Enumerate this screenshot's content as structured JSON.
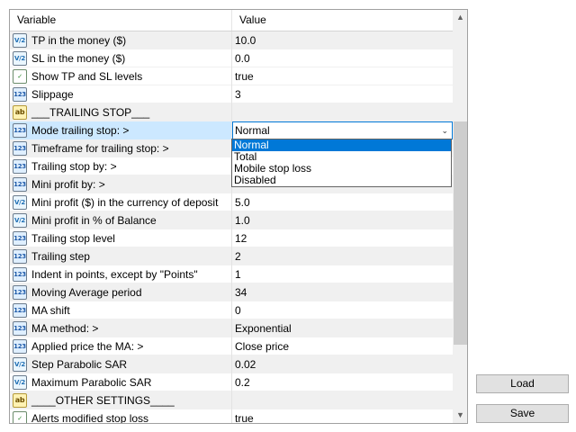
{
  "grid": {
    "headers": {
      "variable": "Variable",
      "value": "Value"
    },
    "rows": [
      {
        "type": "dbl",
        "icon_text": "V/2",
        "name": "TP in the money ($)",
        "value": "10.0",
        "style": "alt"
      },
      {
        "type": "dbl",
        "icon_text": "V/2",
        "name": "SL in the money ($)",
        "value": "0.0",
        "style": ""
      },
      {
        "type": "bool",
        "icon_text": "✓",
        "name": "Show TP and SL levels",
        "value": "true",
        "style": ""
      },
      {
        "type": "int",
        "icon_text": "123",
        "name": "Slippage",
        "value": "3",
        "style": ""
      },
      {
        "type": "str",
        "icon_text": "ab",
        "name": "___TRAILING STOP___",
        "value": "",
        "style": "sep"
      },
      {
        "type": "int",
        "icon_text": "123",
        "name": "Mode trailing stop: >",
        "value": "Normal",
        "style": "sel",
        "combo": true
      },
      {
        "type": "int",
        "icon_text": "123",
        "name": "Timeframe for trailing stop: >",
        "value": "",
        "style": "alt"
      },
      {
        "type": "int",
        "icon_text": "123",
        "name": "Trailing stop by: >",
        "value": "",
        "style": ""
      },
      {
        "type": "int",
        "icon_text": "123",
        "name": "Mini profit by: >",
        "value": "",
        "style": "alt"
      },
      {
        "type": "dbl",
        "icon_text": "V/2",
        "name": "Mini profit ($) in the currency of deposit",
        "value": "5.0",
        "style": ""
      },
      {
        "type": "dbl",
        "icon_text": "V/2",
        "name": "Mini profit in % of Balance",
        "value": "1.0",
        "style": "alt"
      },
      {
        "type": "int",
        "icon_text": "123",
        "name": "Trailing stop level",
        "value": "12",
        "style": ""
      },
      {
        "type": "int",
        "icon_text": "123",
        "name": "Trailing step",
        "value": "2",
        "style": "alt"
      },
      {
        "type": "int",
        "icon_text": "123",
        "name": "Indent in points, except by \"Points\"",
        "value": "1",
        "style": ""
      },
      {
        "type": "int",
        "icon_text": "123",
        "name": "Moving Average period",
        "value": "34",
        "style": "alt"
      },
      {
        "type": "int",
        "icon_text": "123",
        "name": "MA shift",
        "value": "0",
        "style": ""
      },
      {
        "type": "int",
        "icon_text": "123",
        "name": "MA method: >",
        "value": "Exponential",
        "style": "alt"
      },
      {
        "type": "int",
        "icon_text": "123",
        "name": "Applied price the MA: >",
        "value": "Close price",
        "style": ""
      },
      {
        "type": "dbl",
        "icon_text": "V/2",
        "name": "Step Parabolic SAR",
        "value": "0.02",
        "style": "alt"
      },
      {
        "type": "dbl",
        "icon_text": "V/2",
        "name": "Maximum Parabolic SAR",
        "value": "0.2",
        "style": ""
      },
      {
        "type": "str",
        "icon_text": "ab",
        "name": "____OTHER SETTINGS____",
        "value": "",
        "style": "sep"
      },
      {
        "type": "bool",
        "icon_text": "✓",
        "name": "Alerts modified stop loss",
        "value": "true",
        "style": ""
      }
    ]
  },
  "dropdown": {
    "options": [
      "Normal",
      "Total",
      "Mobile stop loss",
      "Disabled"
    ],
    "selected": 0
  },
  "scrollbar": {
    "up_glyph": "▲",
    "down_glyph": "▼"
  },
  "combo_arrow": "⌄",
  "buttons": {
    "load": "Load",
    "save": "Save"
  }
}
